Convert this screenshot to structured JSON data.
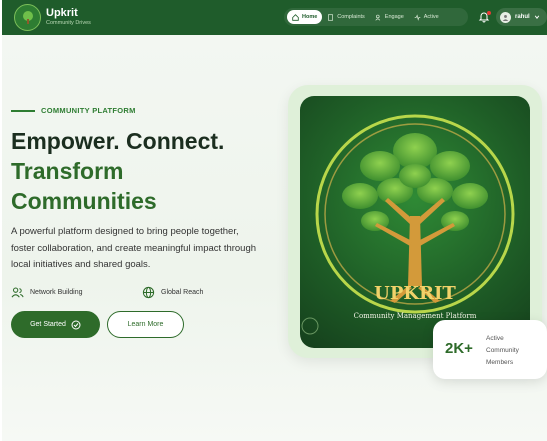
{
  "header": {
    "brand_name": "Upkrit",
    "brand_sub": "Community Drives",
    "nav": [
      {
        "label": "Home",
        "icon": "home-icon",
        "active": true
      },
      {
        "label": "Complaints",
        "icon": "document-icon",
        "active": false
      },
      {
        "label": "Engage",
        "icon": "users-icon",
        "active": false
      },
      {
        "label": "Active",
        "icon": "activity-icon",
        "active": false
      }
    ],
    "user_name": "rahul"
  },
  "hero": {
    "eyebrow": "COMMUNITY PLATFORM",
    "title_line1": "Empower. Connect.",
    "title_line2": "Transform Communities",
    "description": "A powerful platform designed to bring people together, foster collaboration, and create meaningful impact through local initiatives and shared goals.",
    "features": [
      {
        "label": "Network Building",
        "icon": "users-icon"
      },
      {
        "label": "Global Reach",
        "icon": "globe-icon"
      }
    ],
    "primary_button": "Get Started",
    "secondary_button": "Learn More"
  },
  "logo_art": {
    "word": "UPKRIT",
    "tagline": "Community Management Platform"
  },
  "stat": {
    "value": "2K+",
    "label": "Active Community Members"
  },
  "colors": {
    "brand": "#1f5c2b",
    "accent": "#2e6b2a",
    "notification": "#e53935"
  }
}
